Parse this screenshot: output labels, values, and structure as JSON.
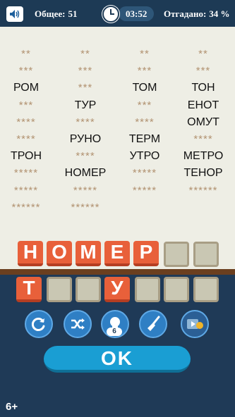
{
  "header": {
    "total_label": "Общее:",
    "total_value": "51",
    "timer": "03:52",
    "guessed_label": "Отгадано:",
    "guessed_value": "34 %"
  },
  "grid": {
    "columns": [
      [
        "**",
        "***",
        "РОМ",
        "***",
        "****",
        "****",
        "ТРОН",
        "*****",
        "*****",
        "******"
      ],
      [
        "**",
        "***",
        "***",
        "ТУР",
        "****",
        "РУНО",
        "****",
        "НОМЕР",
        "*****",
        "******"
      ],
      [
        "**",
        "***",
        "ТОМ",
        "***",
        "****",
        "ТЕРМ",
        "УТРО",
        "*****",
        "*****",
        ""
      ],
      [
        "**",
        "***",
        "ТОН",
        "ЕНОТ",
        "ОМУТ",
        "****",
        "МЕТРО",
        "ТЕНОР",
        "******",
        ""
      ]
    ]
  },
  "current_word": [
    "Н",
    "О",
    "М",
    "Е",
    "Р",
    "",
    ""
  ],
  "letter_pool": [
    "Т",
    "",
    "",
    "У",
    "",
    "",
    ""
  ],
  "hint_count": "6",
  "ok_label": "OK",
  "age_rating": "6+",
  "colors": {
    "tile_red": "#e8603a",
    "tile_empty": "#c9c7b3",
    "board_bg": "#eeeee5",
    "stars": "#b29372",
    "ok_blue": "#1a9ed3",
    "bg_dark": "#1f3a57"
  },
  "icons": [
    "speaker-icon",
    "clock-icon",
    "refresh-icon",
    "shuffle-icon",
    "lightbulb-icon",
    "broom-icon",
    "video-icon"
  ]
}
